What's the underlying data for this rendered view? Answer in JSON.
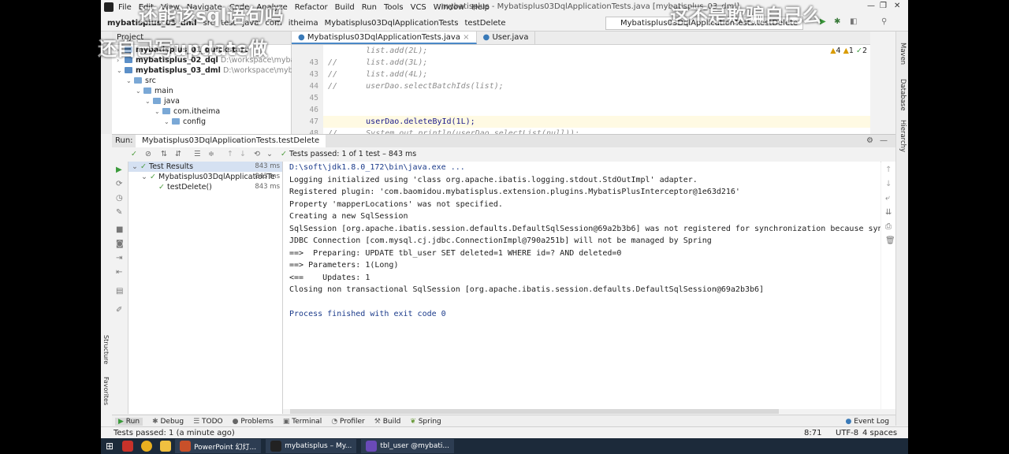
{
  "menu": {
    "items": [
      "File",
      "Edit",
      "View",
      "Navigate",
      "Code",
      "Analyze",
      "Refactor",
      "Build",
      "Run",
      "Tools",
      "VCS",
      "Window",
      "Help"
    ],
    "window_title": "mybatisplus - Mybatisplus03DqlApplicationTests.java [mybatisplus_03_dml]"
  },
  "navbar": {
    "crumbs": [
      "mybatisplus_03_dml",
      "src",
      "test",
      "java",
      "com",
      "itheima",
      "Mybatisplus03DqlApplicationTests",
      "testDelete"
    ],
    "run_config": "Mybatisplus03DqlApplicationTests.testDelete"
  },
  "project": {
    "header": "Project",
    "rows": [
      {
        "label": "mybatisplus_01_quickstart",
        "path": ""
      },
      {
        "label": "mybatisplus_02_dql",
        "path": "D:\\workspace\\mybatisplus"
      },
      {
        "label": "mybatisplus_03_dml",
        "path": "D:\\workspace\\mybatisplus"
      },
      {
        "label": "src",
        "path": ""
      },
      {
        "label": "main",
        "path": ""
      },
      {
        "label": "java",
        "path": ""
      },
      {
        "label": "com.itheima",
        "path": ""
      },
      {
        "label": "config",
        "path": ""
      }
    ]
  },
  "editor": {
    "tabs": [
      "Mybatisplus03DqlApplicationTests.java",
      "User.java"
    ],
    "inspections": {
      "warnings": "4",
      "weak": "1",
      "typos": "2"
    },
    "lines": [
      {
        "num": "",
        "text": "        list.add(2L);"
      },
      {
        "num": "43",
        "text": "//      list.add(3L);"
      },
      {
        "num": "43",
        "text": "//      list.add(4L);"
      },
      {
        "num": "44",
        "text": "//      userDao.selectBatchIds(list);"
      },
      {
        "num": "45",
        "text": ""
      },
      {
        "num": "46",
        "text": ""
      },
      {
        "num": "47",
        "text": "        userDao.deleteById(1L);"
      },
      {
        "num": "48",
        "text": "//      System.out.println(userDao.selectList(null));"
      }
    ]
  },
  "run": {
    "label": "Run:",
    "tab": "Mybatisplus03DqlApplicationTests.testDelete",
    "status": "Tests passed: 1 of 1 test – 843 ms",
    "tree": [
      {
        "label": "Test Results",
        "dur": "843 ms"
      },
      {
        "label": "Mybatisplus03DqlApplicationTe",
        "dur": "843 ms"
      },
      {
        "label": "testDelete()",
        "dur": "843 ms"
      }
    ],
    "console": [
      "D:\\soft\\jdk1.8.0_172\\bin\\java.exe ...",
      "Logging initialized using 'class org.apache.ibatis.logging.stdout.StdOutImpl' adapter.",
      "Registered plugin: 'com.baomidou.mybatisplus.extension.plugins.MybatisPlusInterceptor@1e63d216'",
      "Property 'mapperLocations' was not specified.",
      "Creating a new SqlSession",
      "SqlSession [org.apache.ibatis.session.defaults.DefaultSqlSession@69a2b3b6] was not registered for synchronization because synchr",
      "JDBC Connection [com.mysql.cj.jdbc.ConnectionImpl@790a251b] will not be managed by Spring",
      "==>  Preparing: UPDATE tbl_user SET deleted=1 WHERE id=? AND deleted=0",
      "==> Parameters: 1(Long)",
      "<==    Updates: 1",
      "Closing non transactional SqlSession [org.apache.ibatis.session.defaults.DefaultSqlSession@69a2b3b6]",
      "",
      "Process finished with exit code 0"
    ]
  },
  "bottom_tabs": [
    "Run",
    "Debug",
    "TODO",
    "Problems",
    "Terminal",
    "Profiler",
    "Build",
    "Spring"
  ],
  "event_log": "Event Log",
  "statusbar": {
    "message": "Tests passed: 1 (a minute ago)",
    "position": "8:71",
    "encoding": "UTF-8",
    "indent": "4 spaces"
  },
  "right_strip": [
    "Maven",
    "Database",
    "Hierarchy"
  ],
  "left_strip": [
    "Structure",
    "Favorites"
  ],
  "taskbar": {
    "apps": [
      "PowerPoint 幻灯...",
      "mybatisplus – My...",
      "tbl_user @mybati..."
    ]
  },
  "overlay": {
    "line1": "还能该sql语句吗",
    "line2": "这不是欺骗自己么",
    "line3": "还自己写update做"
  }
}
